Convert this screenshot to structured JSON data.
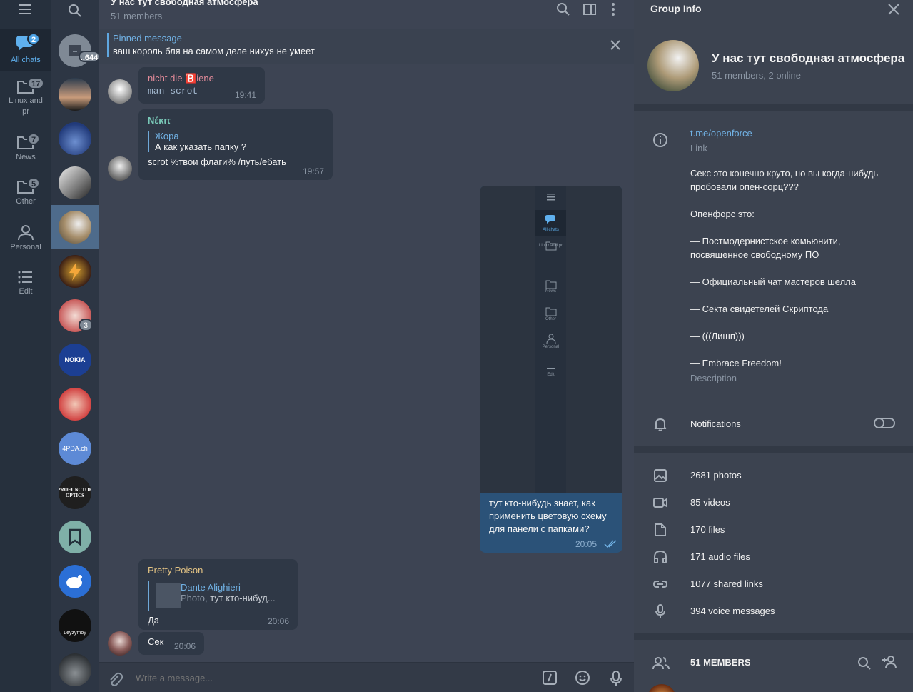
{
  "sidebar": {
    "folders": [
      {
        "label": "All chats",
        "badge": "2"
      },
      {
        "label": "Linux and pr",
        "badge": "17"
      },
      {
        "label": "News",
        "badge": "7"
      },
      {
        "label": "Other",
        "badge": "5"
      },
      {
        "label": "Personal",
        "badge": ""
      },
      {
        "label": "Edit",
        "badge": ""
      }
    ]
  },
  "chatlist": {
    "archive_count": "..644",
    "unread_badge": "3",
    "avatars_text": {
      "nokia": "NOKIA",
      "fourpda": "4PDA.ch",
      "profunctor": "PROFUNCTOR OPTICS",
      "leyzymoy": "Leyzymoy"
    }
  },
  "chat": {
    "title": "У нас тут свободная атмосфера",
    "subtitle": "51 members",
    "pinned_label": "Pinned message",
    "pinned_text": "ваш король бля на самом деле нихуя не умеет",
    "messages": [
      {
        "author": "nicht die 🅱️iene",
        "text": "man scrot",
        "time": "19:41"
      },
      {
        "author": "Nέκιτ",
        "reply_author": "Жора",
        "reply_text": "А как указать папку ?",
        "text": "scrot %твои флаги% /путь/ебать",
        "time": "19:57"
      },
      {
        "text": "тут кто-нибудь знает, как применить цветовую схему для панели с папками?",
        "time": "20:05"
      },
      {
        "author": "Pretty Poison",
        "reply_author": "Dante Alighieri",
        "reply_prefix": "Photo,",
        "reply_text": " тут кто-нибуд...",
        "text": "Да",
        "time": "20:06"
      },
      {
        "text": "Сек",
        "time": "20:06"
      }
    ],
    "screenshot_folders": [
      {
        "label": "All chats",
        "badge": "2"
      },
      {
        "label": "Linux and pr",
        "badge": "17"
      },
      {
        "label": "News",
        "badge": "7"
      },
      {
        "label": "Other",
        "badge": "5"
      },
      {
        "label": "Personal",
        "badge": ""
      },
      {
        "label": "Edit",
        "badge": ""
      }
    ],
    "composer_placeholder": "Write a message..."
  },
  "info": {
    "title": "Group Info",
    "group_name": "У нас тут свободная атмосфера",
    "group_status": "51 members, 2 online",
    "link": "t.me/openforce",
    "link_label": "Link",
    "description": [
      "Секс это конечно круто, но вы когда-нибудь пробовали опен-сорц???",
      "Опенфорс это:",
      "— Постмодернистское комьюнити, посвященное свободному ПО",
      "— Официальный чат мастеров шелла",
      "— Секта свидетелей Скриптода",
      "— (((Лишп)))",
      "— Embrace Freedom!"
    ],
    "description_label": "Description",
    "notifications_label": "Notifications",
    "media": [
      {
        "icon": "photo-icon",
        "label": "2681 photos"
      },
      {
        "icon": "video-icon",
        "label": "85 videos"
      },
      {
        "icon": "file-icon",
        "label": "170 files"
      },
      {
        "icon": "headphones-icon",
        "label": "171 audio files"
      },
      {
        "icon": "link-icon",
        "label": "1077 shared links"
      },
      {
        "icon": "mic-icon",
        "label": "394 voice messages"
      }
    ],
    "members_label": "51 MEMBERS"
  },
  "colors": {
    "accent": "#5fb0ee",
    "outgoing": "#2b5278",
    "incoming": "#2f3846"
  }
}
